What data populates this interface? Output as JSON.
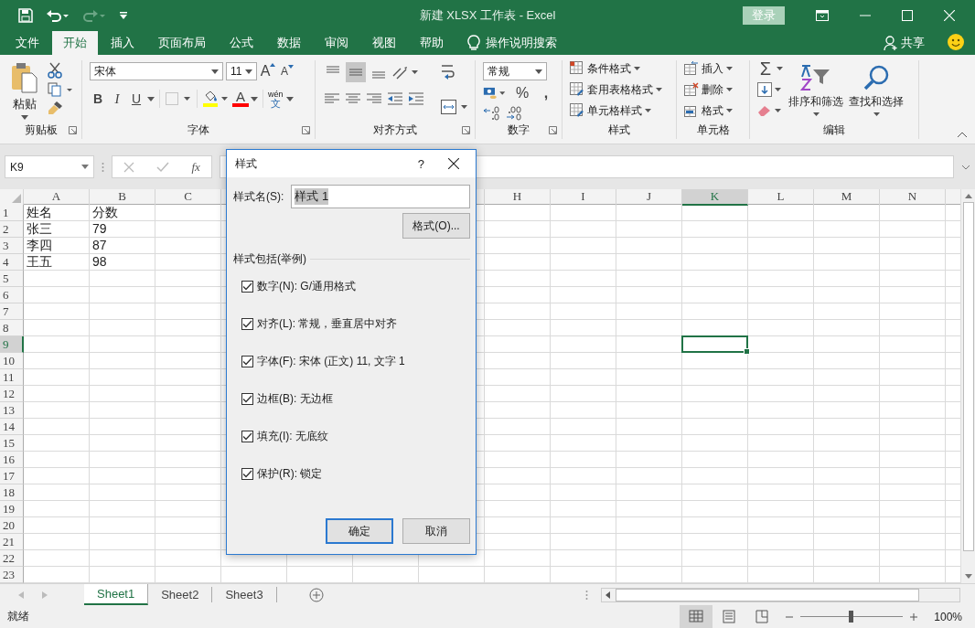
{
  "window": {
    "title": "新建 XLSX 工作表  -  Excel",
    "login_button": "登录"
  },
  "menu_tabs": [
    {
      "label": "文件",
      "selected": false
    },
    {
      "label": "开始",
      "selected": true
    },
    {
      "label": "插入",
      "selected": false
    },
    {
      "label": "页面布局",
      "selected": false
    },
    {
      "label": "公式",
      "selected": false
    },
    {
      "label": "数据",
      "selected": false
    },
    {
      "label": "审阅",
      "selected": false
    },
    {
      "label": "视图",
      "selected": false
    },
    {
      "label": "帮助",
      "selected": false
    }
  ],
  "tell_me": "操作说明搜索",
  "share": "共享",
  "ribbon": {
    "clipboard": {
      "paste": "粘贴",
      "label": "剪贴板"
    },
    "font": {
      "font_name": "宋体",
      "font_size": "11",
      "grow": "A",
      "shrink": "A",
      "bold": "B",
      "italic": "I",
      "underline": "U",
      "font_color": "A",
      "phonetic_top": "wén",
      "phonetic_bottom": "文",
      "label": "字体"
    },
    "alignment": {
      "vertical_align": [
        {
          "kind": "top",
          "selected": false
        },
        {
          "kind": "middle",
          "selected": true
        },
        {
          "kind": "bottom",
          "selected": false
        }
      ],
      "label": "对齐方式"
    },
    "number": {
      "format": "常规",
      "percent": "%",
      "comma": ",",
      "label": "数字"
    },
    "styles": {
      "items": [
        "条件格式",
        "套用表格格式",
        "单元格样式"
      ],
      "label": "样式"
    },
    "cells": {
      "items": [
        "插入",
        "删除",
        "格式"
      ],
      "label": "单元格"
    },
    "editing": {
      "sum": "Σ",
      "sort": "排序和筛选",
      "find": "查找和选择",
      "label": "编辑"
    }
  },
  "formula_bar": {
    "name_box": "K9",
    "fx": "fx"
  },
  "sheet": {
    "columns_left": [
      {
        "label": "A",
        "selected": false
      },
      {
        "label": "B",
        "selected": false
      },
      {
        "label": "C",
        "selected": false
      }
    ],
    "columns_right": [
      {
        "label": "H",
        "selected": false
      },
      {
        "label": "I",
        "selected": false
      },
      {
        "label": "J",
        "selected": false
      },
      {
        "label": "K",
        "selected": true
      },
      {
        "label": "L",
        "selected": false
      },
      {
        "label": "M",
        "selected": false
      },
      {
        "label": "N",
        "selected": false
      }
    ],
    "rows": [
      {
        "header": "1",
        "selected": false,
        "cells": [
          "姓名",
          "分数"
        ]
      },
      {
        "header": "2",
        "selected": false,
        "cells": [
          "张三",
          "79"
        ]
      },
      {
        "header": "3",
        "selected": false,
        "cells": [
          "李四",
          "87"
        ]
      },
      {
        "header": "4",
        "selected": false,
        "cells": [
          "王五",
          "98"
        ]
      },
      {
        "header": "5",
        "selected": false
      },
      {
        "header": "6",
        "selected": false
      },
      {
        "header": "7",
        "selected": false
      },
      {
        "header": "8",
        "selected": false
      },
      {
        "header": "9",
        "selected": true
      },
      {
        "header": "10",
        "selected": false
      },
      {
        "header": "11",
        "selected": false
      },
      {
        "header": "12",
        "selected": false
      },
      {
        "header": "13",
        "selected": false
      },
      {
        "header": "14",
        "selected": false
      },
      {
        "header": "15",
        "selected": false
      },
      {
        "header": "16",
        "selected": false
      },
      {
        "header": "17",
        "selected": false
      },
      {
        "header": "18",
        "selected": false
      },
      {
        "header": "19",
        "selected": false
      },
      {
        "header": "20",
        "selected": false
      },
      {
        "header": "21",
        "selected": false
      },
      {
        "header": "22",
        "selected": false
      },
      {
        "header": "23",
        "selected": false
      }
    ]
  },
  "sheet_tabs": [
    {
      "label": "Sheet1",
      "selected": true
    },
    {
      "label": "Sheet2",
      "selected": false
    },
    {
      "label": "Sheet3",
      "selected": false
    }
  ],
  "status_bar": {
    "status": "就绪",
    "view_modes": [
      {
        "kind": "normal",
        "selected": true
      },
      {
        "kind": "page_layout",
        "selected": false
      },
      {
        "kind": "page_break",
        "selected": false
      }
    ],
    "zoom": {
      "level": 0.5
    },
    "zoom_text": "100%"
  },
  "dialog": {
    "title": "样式",
    "help": "?",
    "name_label": "样式名(S):",
    "name_value": "样式 1",
    "name_value_selected": true,
    "format_button": "格式(O)...",
    "section": "样式包括(举例)",
    "options": [
      {
        "label": "数字(N): G/通用格式",
        "checked": true
      },
      {
        "label": "对齐(L): 常规，垂直居中对齐",
        "checked": true
      },
      {
        "label": "字体(F): 宋体 (正文) 11, 文字 1",
        "checked": true
      },
      {
        "label": "边框(B): 无边框",
        "checked": true
      },
      {
        "label": "填充(I): 无底纹",
        "checked": true
      },
      {
        "label": "保护(R): 锁定",
        "checked": true
      }
    ],
    "ok": "确定",
    "cancel": "取消"
  }
}
